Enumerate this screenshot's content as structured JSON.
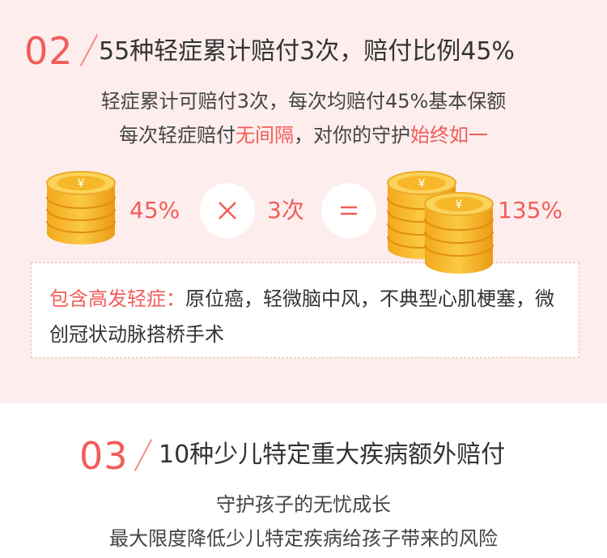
{
  "section2": {
    "number": "02",
    "title": "55种轻症累计赔付3次，赔付比例45%",
    "line1": "轻症累计可赔付3次，每次均赔付45%基本保额",
    "line2_prefix": "每次轻症赔付",
    "line2_highlight1": "无间隔",
    "line2_mid": "，对你的守护",
    "line2_highlight2": "始终如一",
    "formula": {
      "percent": "45%",
      "times_symbol": "×",
      "count": "3次",
      "equals_symbol": "=",
      "result": "135%",
      "coin_symbol": "¥"
    },
    "info_label": "包含高发轻症：",
    "info_text": "原位癌，轻微脑中风，不典型心肌梗塞，微创冠状动脉搭桥手术"
  },
  "section3": {
    "number": "03",
    "title": "10种少儿特定重大疾病额外赔付",
    "line1": "守护孩子的无忧成长",
    "line2": "最大限度降低少儿特定疾病给孩子带来的风险"
  },
  "colors": {
    "accent": "#f15d59",
    "pink_bg": "#fdeeed",
    "coin_gold": "#f6b92a",
    "text": "#333333"
  }
}
